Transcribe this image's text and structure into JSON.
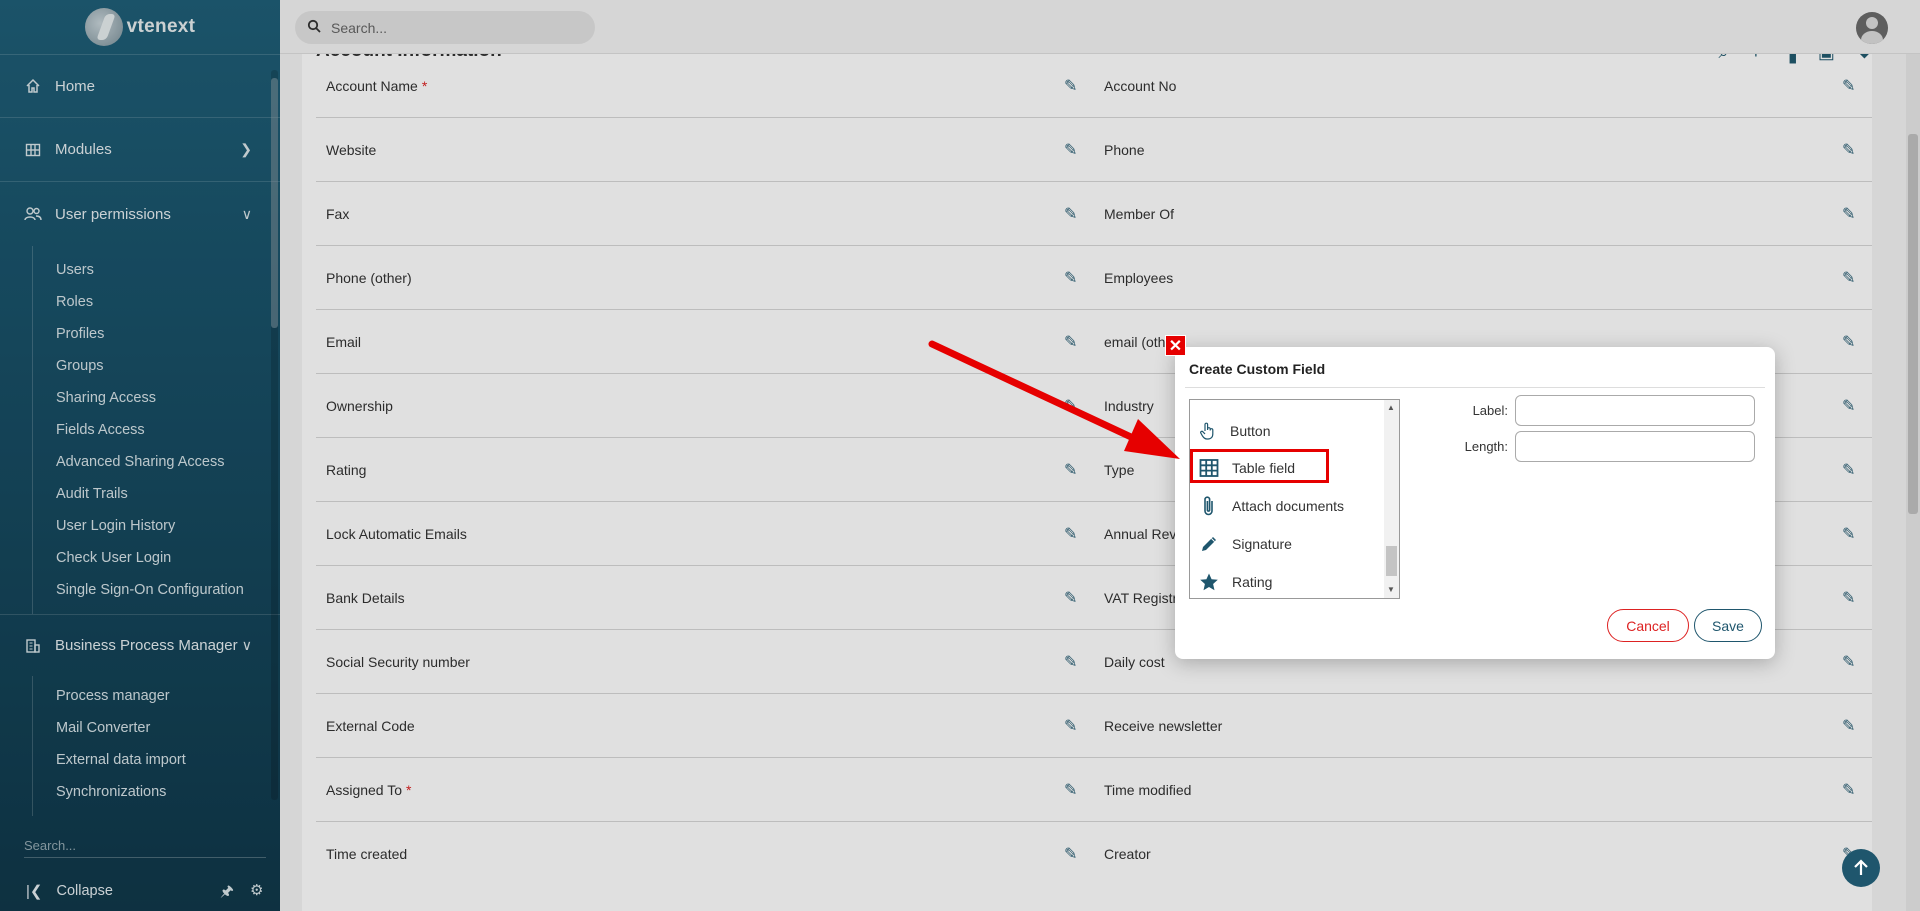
{
  "sidebar": {
    "logo_text": "vtenext",
    "main_items": [
      {
        "label": "Home",
        "icon": "home-icon"
      },
      {
        "label": "Modules",
        "icon": "grid-icon"
      },
      {
        "label": "User permissions",
        "icon": "users-icon"
      }
    ],
    "user_permissions_items": [
      "Users",
      "Roles",
      "Profiles",
      "Groups",
      "Sharing Access",
      "Fields Access",
      "Advanced Sharing Access",
      "Audit Trails",
      "User Login History",
      "Check User Login",
      "Single Sign-On Configuration"
    ],
    "bpm_label": "Business Process Manager",
    "bpm_items": [
      "Process manager",
      "Mail Converter",
      "External data import",
      "Synchronizations"
    ],
    "search_placeholder": "Search...",
    "collapse_label": "Collapse"
  },
  "topbar": {
    "search_placeholder": "Search..."
  },
  "content": {
    "section_title": "Account Information",
    "rows": [
      {
        "left": "Account Name",
        "left_required": "*",
        "right": "Account No"
      },
      {
        "left": "Website",
        "right": "Phone"
      },
      {
        "left": "Fax",
        "right": "Member Of"
      },
      {
        "left": "Phone (other)",
        "right": "Employees"
      },
      {
        "left": "Email",
        "right": "email (other)"
      },
      {
        "left": "Ownership",
        "right": "Industry"
      },
      {
        "left": "Rating",
        "right": "Type"
      },
      {
        "left": "Lock Automatic Emails",
        "right": "Annual Revenue"
      },
      {
        "left": "Bank Details",
        "right": "VAT Registration"
      },
      {
        "left": "Social Security number",
        "right": "Daily cost"
      },
      {
        "left": "External Code",
        "right": "Receive newsletter"
      },
      {
        "left": "Assigned To",
        "left_required": "*",
        "right": "Time modified"
      },
      {
        "left": "Time created",
        "right": "Creator"
      }
    ]
  },
  "modal": {
    "title": "Create Custom Field",
    "types": [
      {
        "label": "Button",
        "icon": "hand-pointer-icon"
      },
      {
        "label": "Table field",
        "icon": "table-grid-icon"
      },
      {
        "label": "Attach documents",
        "icon": "paperclip-icon"
      },
      {
        "label": "Signature",
        "icon": "pen-icon"
      },
      {
        "label": "Rating",
        "icon": "star-icon"
      }
    ],
    "label_field": "Label:",
    "length_field": "Length:",
    "cancel": "Cancel",
    "save": "Save"
  },
  "colors": {
    "sidebar": "#184f66",
    "accent": "#1f566d",
    "annotation": "#e60000"
  }
}
